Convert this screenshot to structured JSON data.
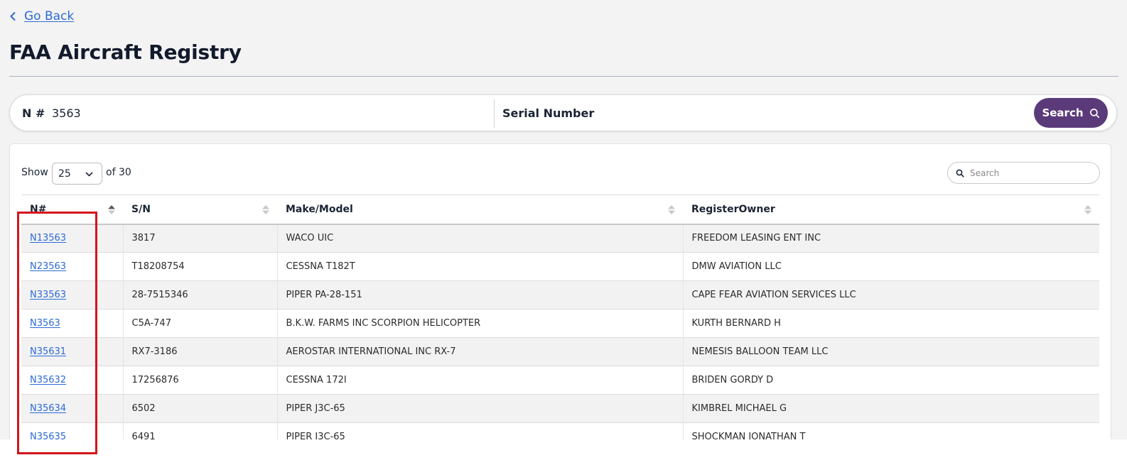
{
  "nav": {
    "back_label": "Go Back"
  },
  "page_title": "FAA Aircraft Registry",
  "search_bar": {
    "n_label": "N #",
    "n_value": "3563",
    "serial_label": "Serial Number",
    "button_label": "Search"
  },
  "table_controls": {
    "show_label": "Show",
    "page_size": "25",
    "of_label": "of 30",
    "search_placeholder": "Search"
  },
  "columns": [
    "N#",
    "S/N",
    "Make/Model",
    "RegisterOwner"
  ],
  "rows": [
    {
      "n": "N13563",
      "sn": "3817",
      "make_model": "WACO UIC",
      "owner": "FREEDOM LEASING ENT INC"
    },
    {
      "n": "N23563",
      "sn": "T18208754",
      "make_model": "CESSNA T182T",
      "owner": "DMW AVIATION LLC"
    },
    {
      "n": "N33563",
      "sn": "28-7515346",
      "make_model": "PIPER PA-28-151",
      "owner": "CAPE FEAR AVIATION SERVICES LLC"
    },
    {
      "n": "N3563",
      "sn": "C5A-747",
      "make_model": "B.K.W. FARMS INC SCORPION HELICOPTER",
      "owner": "KURTH BERNARD H"
    },
    {
      "n": "N35631",
      "sn": "RX7-3186",
      "make_model": "AEROSTAR INTERNATIONAL INC RX-7",
      "owner": "NEMESIS BALLOON TEAM LLC"
    },
    {
      "n": "N35632",
      "sn": "17256876",
      "make_model": "CESSNA 172I",
      "owner": "BRIDEN GORDY D"
    },
    {
      "n": "N35634",
      "sn": "6502",
      "make_model": "PIPER J3C-65",
      "owner": "KIMBREL MICHAEL G"
    },
    {
      "n": "N35635",
      "sn": "6491",
      "make_model": "PIPER J3C-65",
      "owner": "SHOCKMAN JONATHAN T"
    }
  ],
  "colors": {
    "accent": "#5b3a7a",
    "link": "#2c6ad6",
    "highlight": "#d3141c"
  },
  "icons": [
    "chevron-left-icon",
    "search-icon",
    "chevron-down-icon",
    "sort-icon"
  ]
}
